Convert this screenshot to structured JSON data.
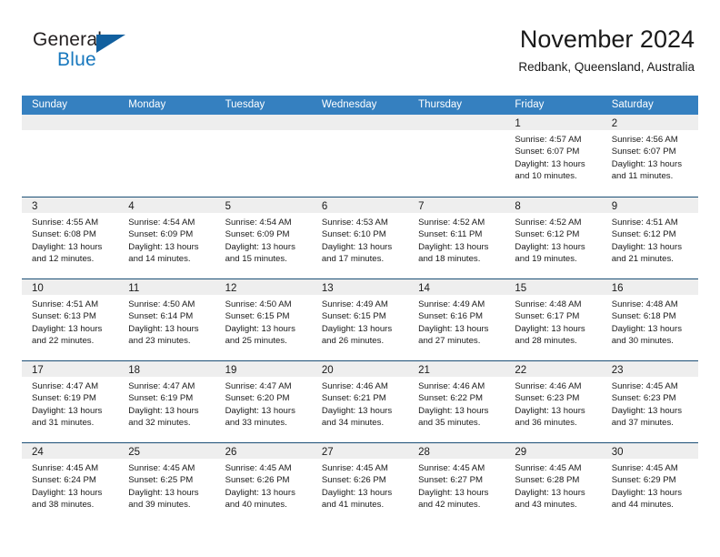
{
  "brand": {
    "name_part1": "General",
    "name_part2": "Blue",
    "accent_color": "#1878be",
    "triangle_color": "#12609f",
    "logo_icon": "triangle-flag-icon"
  },
  "header": {
    "title": "November 2024",
    "subtitle": "Redbank, Queensland, Australia"
  },
  "calendar": {
    "header_bg": "#3580c0",
    "header_text_color": "#ffffff",
    "row_divider_color": "#1c4f76",
    "daynum_band_color": "#eeeeee",
    "weekday_headers": [
      "Sunday",
      "Monday",
      "Tuesday",
      "Wednesday",
      "Thursday",
      "Friday",
      "Saturday"
    ],
    "labels": {
      "sunrise": "Sunrise:",
      "sunset": "Sunset:",
      "daylight": "Daylight:"
    },
    "weeks": [
      [
        {
          "day": "",
          "lines": []
        },
        {
          "day": "",
          "lines": []
        },
        {
          "day": "",
          "lines": []
        },
        {
          "day": "",
          "lines": []
        },
        {
          "day": "",
          "lines": []
        },
        {
          "day": "1",
          "lines": [
            "Sunrise: 4:57 AM",
            "Sunset: 6:07 PM",
            "Daylight: 13 hours",
            "and 10 minutes."
          ]
        },
        {
          "day": "2",
          "lines": [
            "Sunrise: 4:56 AM",
            "Sunset: 6:07 PM",
            "Daylight: 13 hours",
            "and 11 minutes."
          ]
        }
      ],
      [
        {
          "day": "3",
          "lines": [
            "Sunrise: 4:55 AM",
            "Sunset: 6:08 PM",
            "Daylight: 13 hours",
            "and 12 minutes."
          ]
        },
        {
          "day": "4",
          "lines": [
            "Sunrise: 4:54 AM",
            "Sunset: 6:09 PM",
            "Daylight: 13 hours",
            "and 14 minutes."
          ]
        },
        {
          "day": "5",
          "lines": [
            "Sunrise: 4:54 AM",
            "Sunset: 6:09 PM",
            "Daylight: 13 hours",
            "and 15 minutes."
          ]
        },
        {
          "day": "6",
          "lines": [
            "Sunrise: 4:53 AM",
            "Sunset: 6:10 PM",
            "Daylight: 13 hours",
            "and 17 minutes."
          ]
        },
        {
          "day": "7",
          "lines": [
            "Sunrise: 4:52 AM",
            "Sunset: 6:11 PM",
            "Daylight: 13 hours",
            "and 18 minutes."
          ]
        },
        {
          "day": "8",
          "lines": [
            "Sunrise: 4:52 AM",
            "Sunset: 6:12 PM",
            "Daylight: 13 hours",
            "and 19 minutes."
          ]
        },
        {
          "day": "9",
          "lines": [
            "Sunrise: 4:51 AM",
            "Sunset: 6:12 PM",
            "Daylight: 13 hours",
            "and 21 minutes."
          ]
        }
      ],
      [
        {
          "day": "10",
          "lines": [
            "Sunrise: 4:51 AM",
            "Sunset: 6:13 PM",
            "Daylight: 13 hours",
            "and 22 minutes."
          ]
        },
        {
          "day": "11",
          "lines": [
            "Sunrise: 4:50 AM",
            "Sunset: 6:14 PM",
            "Daylight: 13 hours",
            "and 23 minutes."
          ]
        },
        {
          "day": "12",
          "lines": [
            "Sunrise: 4:50 AM",
            "Sunset: 6:15 PM",
            "Daylight: 13 hours",
            "and 25 minutes."
          ]
        },
        {
          "day": "13",
          "lines": [
            "Sunrise: 4:49 AM",
            "Sunset: 6:15 PM",
            "Daylight: 13 hours",
            "and 26 minutes."
          ]
        },
        {
          "day": "14",
          "lines": [
            "Sunrise: 4:49 AM",
            "Sunset: 6:16 PM",
            "Daylight: 13 hours",
            "and 27 minutes."
          ]
        },
        {
          "day": "15",
          "lines": [
            "Sunrise: 4:48 AM",
            "Sunset: 6:17 PM",
            "Daylight: 13 hours",
            "and 28 minutes."
          ]
        },
        {
          "day": "16",
          "lines": [
            "Sunrise: 4:48 AM",
            "Sunset: 6:18 PM",
            "Daylight: 13 hours",
            "and 30 minutes."
          ]
        }
      ],
      [
        {
          "day": "17",
          "lines": [
            "Sunrise: 4:47 AM",
            "Sunset: 6:19 PM",
            "Daylight: 13 hours",
            "and 31 minutes."
          ]
        },
        {
          "day": "18",
          "lines": [
            "Sunrise: 4:47 AM",
            "Sunset: 6:19 PM",
            "Daylight: 13 hours",
            "and 32 minutes."
          ]
        },
        {
          "day": "19",
          "lines": [
            "Sunrise: 4:47 AM",
            "Sunset: 6:20 PM",
            "Daylight: 13 hours",
            "and 33 minutes."
          ]
        },
        {
          "day": "20",
          "lines": [
            "Sunrise: 4:46 AM",
            "Sunset: 6:21 PM",
            "Daylight: 13 hours",
            "and 34 minutes."
          ]
        },
        {
          "day": "21",
          "lines": [
            "Sunrise: 4:46 AM",
            "Sunset: 6:22 PM",
            "Daylight: 13 hours",
            "and 35 minutes."
          ]
        },
        {
          "day": "22",
          "lines": [
            "Sunrise: 4:46 AM",
            "Sunset: 6:23 PM",
            "Daylight: 13 hours",
            "and 36 minutes."
          ]
        },
        {
          "day": "23",
          "lines": [
            "Sunrise: 4:45 AM",
            "Sunset: 6:23 PM",
            "Daylight: 13 hours",
            "and 37 minutes."
          ]
        }
      ],
      [
        {
          "day": "24",
          "lines": [
            "Sunrise: 4:45 AM",
            "Sunset: 6:24 PM",
            "Daylight: 13 hours",
            "and 38 minutes."
          ]
        },
        {
          "day": "25",
          "lines": [
            "Sunrise: 4:45 AM",
            "Sunset: 6:25 PM",
            "Daylight: 13 hours",
            "and 39 minutes."
          ]
        },
        {
          "day": "26",
          "lines": [
            "Sunrise: 4:45 AM",
            "Sunset: 6:26 PM",
            "Daylight: 13 hours",
            "and 40 minutes."
          ]
        },
        {
          "day": "27",
          "lines": [
            "Sunrise: 4:45 AM",
            "Sunset: 6:26 PM",
            "Daylight: 13 hours",
            "and 41 minutes."
          ]
        },
        {
          "day": "28",
          "lines": [
            "Sunrise: 4:45 AM",
            "Sunset: 6:27 PM",
            "Daylight: 13 hours",
            "and 42 minutes."
          ]
        },
        {
          "day": "29",
          "lines": [
            "Sunrise: 4:45 AM",
            "Sunset: 6:28 PM",
            "Daylight: 13 hours",
            "and 43 minutes."
          ]
        },
        {
          "day": "30",
          "lines": [
            "Sunrise: 4:45 AM",
            "Sunset: 6:29 PM",
            "Daylight: 13 hours",
            "and 44 minutes."
          ]
        }
      ]
    ]
  }
}
